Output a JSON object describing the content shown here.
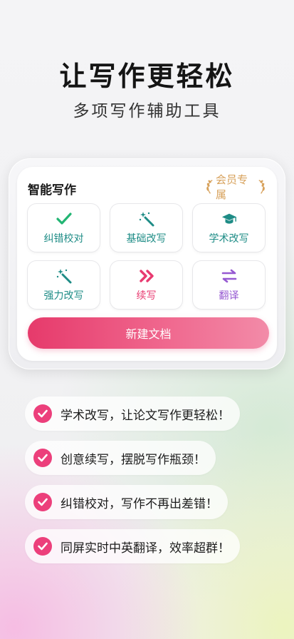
{
  "hero": {
    "title": "让写作更轻松",
    "subtitle": "多项写作辅助工具"
  },
  "card": {
    "title": "智能写作",
    "vip_badge": "会员专属",
    "tools": [
      {
        "label": "纠错校对",
        "icon": "check-icon",
        "color": "#1e8c86"
      },
      {
        "label": "基础改写",
        "icon": "magic-wand-icon",
        "color": "#1e8c86"
      },
      {
        "label": "学术改写",
        "icon": "graduation-cap-icon",
        "color": "#1e8c86"
      },
      {
        "label": "强力改写",
        "icon": "magic-wand-icon",
        "color": "#1e8c86"
      },
      {
        "label": "续写",
        "icon": "double-chevron-right-icon",
        "color": "#e83a70"
      },
      {
        "label": "翻译",
        "icon": "swap-arrows-icon",
        "color": "#9659d1"
      }
    ],
    "new_doc_button": "新建文档"
  },
  "features": [
    "学术改写，让论文写作更轻松！",
    "创意续写，摆脱写作瓶颈！",
    "纠错校对，写作不再出差错！",
    "同屏实时中英翻译，效率超群！"
  ],
  "colors": {
    "accent_pink": "#ec3f7b",
    "teal": "#1e8c86",
    "purple": "#9659d1",
    "gold": "#d7a15b"
  }
}
